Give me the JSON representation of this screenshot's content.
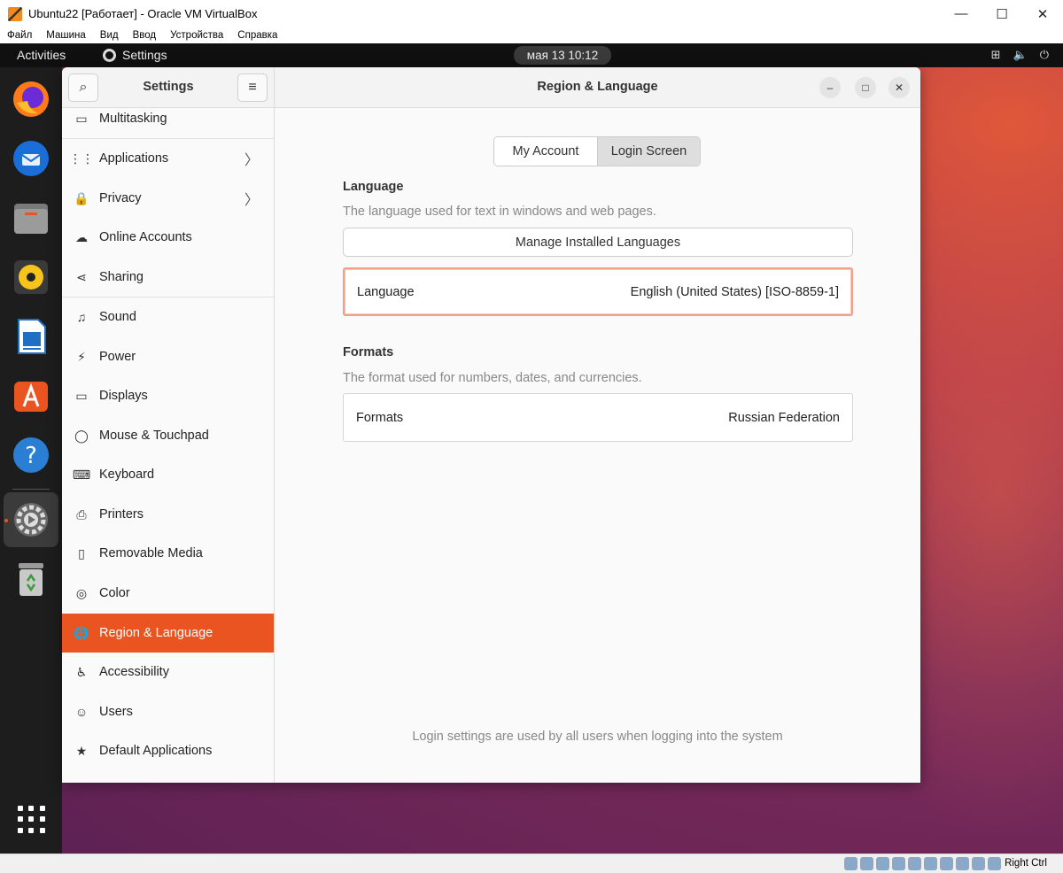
{
  "host_window": {
    "title": "Ubuntu22 [Работает] - Oracle VM VirtualBox",
    "controls": {
      "minimize": "—",
      "maximize": "☐",
      "close": "✕"
    },
    "menu": [
      "Файл",
      "Машина",
      "Вид",
      "Ввод",
      "Устройства",
      "Справка"
    ],
    "status": {
      "host_key": "Right Ctrl"
    }
  },
  "topbar": {
    "activities": "Activities",
    "app_name": "Settings",
    "clock": "мая 13  10:12",
    "tray": {
      "network": "⊞",
      "volume": "🔈",
      "power": "⏻"
    }
  },
  "dock": {
    "apps": [
      "firefox-icon",
      "thunderbird-icon",
      "files-icon",
      "rhythmbox-icon",
      "libreoffice-writer-icon",
      "app-center-icon",
      "help-icon",
      "settings-icon",
      "trash-icon"
    ],
    "active": "settings-icon"
  },
  "settings": {
    "sidebar_title": "Settings",
    "search_icon": "⌕",
    "menu_icon": "≡",
    "content_title": "Region & Language",
    "window_controls": {
      "minimize": "–",
      "maximize": "□",
      "close": "✕"
    },
    "sidebar_items": [
      {
        "label": "Multitasking",
        "icon": "▭",
        "chevron": false
      },
      {
        "label": "Applications",
        "icon": "⋮⋮",
        "chevron": true
      },
      {
        "label": "Privacy",
        "icon": "🔒",
        "chevron": true
      },
      {
        "label": "Online Accounts",
        "icon": "☁",
        "chevron": false
      },
      {
        "label": "Sharing",
        "icon": "⋖",
        "chevron": false
      },
      {
        "label": "Sound",
        "icon": "♫",
        "chevron": false
      },
      {
        "label": "Power",
        "icon": "⚡",
        "chevron": false
      },
      {
        "label": "Displays",
        "icon": "▭",
        "chevron": false
      },
      {
        "label": "Mouse & Touchpad",
        "icon": "◯",
        "chevron": false
      },
      {
        "label": "Keyboard",
        "icon": "⌨",
        "chevron": false
      },
      {
        "label": "Printers",
        "icon": "⎙",
        "chevron": false
      },
      {
        "label": "Removable Media",
        "icon": "▯",
        "chevron": false
      },
      {
        "label": "Color",
        "icon": "◎",
        "chevron": false
      },
      {
        "label": "Region & Language",
        "icon": "🌐",
        "chevron": false
      },
      {
        "label": "Accessibility",
        "icon": "♿",
        "chevron": false
      },
      {
        "label": "Users",
        "icon": "☺",
        "chevron": false
      },
      {
        "label": "Default Applications",
        "icon": "★",
        "chevron": false
      }
    ],
    "active_item": "Region & Language",
    "chevron": "〉",
    "tabs": {
      "my_account": "My Account",
      "login_screen": "Login Screen",
      "selected": "Login Screen"
    },
    "language": {
      "title": "Language",
      "subtitle": "The language used for text in windows and web pages.",
      "manage_button": "Manage Installed Languages",
      "row_label": "Language",
      "row_value": "English (United States) [ISO-8859-1]"
    },
    "formats": {
      "title": "Formats",
      "subtitle": "The format used for numbers, dates, and currencies.",
      "row_label": "Formats",
      "row_value": "Russian Federation"
    },
    "footer_note": "Login settings are used by all users when logging into the system"
  },
  "colors": {
    "accent": "#e95420",
    "dock_bg": "#1d1d1d",
    "topbar_bg": "#101010"
  }
}
